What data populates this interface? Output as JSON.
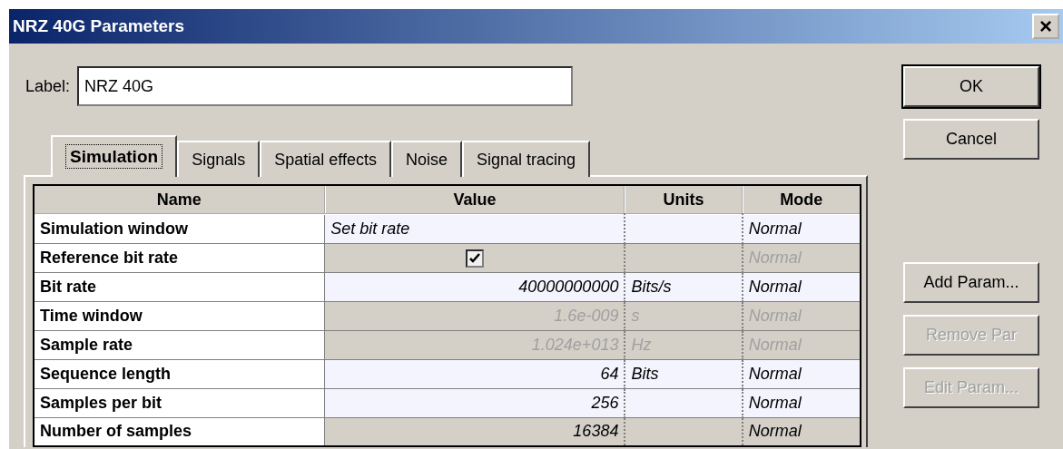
{
  "window": {
    "title": "NRZ 40G Parameters",
    "close": "×"
  },
  "label_field": {
    "label": "Label:",
    "value": "NRZ 40G"
  },
  "tabs": [
    {
      "label": "Simulation",
      "selected": true
    },
    {
      "label": "Signals",
      "selected": false
    },
    {
      "label": "Spatial effects",
      "selected": false
    },
    {
      "label": "Noise",
      "selected": false
    },
    {
      "label": "Signal tracing",
      "selected": false
    }
  ],
  "table": {
    "columns": [
      "Name",
      "Value",
      "Units",
      "Mode"
    ],
    "rows": [
      {
        "name": "Simulation window",
        "kind": "text",
        "value": "Set bit rate",
        "units": "",
        "mode": "Normal",
        "editable": true,
        "disabled": false
      },
      {
        "name": "Reference bit rate",
        "kind": "checkbox",
        "checked": true,
        "units": "",
        "mode": "Normal",
        "editable": false,
        "disabled": true
      },
      {
        "name": "Bit rate",
        "kind": "number",
        "value": "40000000000",
        "units": "Bits/s",
        "mode": "Normal",
        "editable": true,
        "disabled": false
      },
      {
        "name": "Time window",
        "kind": "number",
        "value": "1.6e-009",
        "units": "s",
        "mode": "Normal",
        "editable": false,
        "disabled": true
      },
      {
        "name": "Sample rate",
        "kind": "number",
        "value": "1.024e+013",
        "units": "Hz",
        "mode": "Normal",
        "editable": false,
        "disabled": true
      },
      {
        "name": "Sequence length",
        "kind": "number",
        "value": "64",
        "units": "Bits",
        "mode": "Normal",
        "editable": true,
        "disabled": false
      },
      {
        "name": "Samples per bit",
        "kind": "number",
        "value": "256",
        "units": "",
        "mode": "Normal",
        "editable": true,
        "disabled": false
      },
      {
        "name": "Number of samples",
        "kind": "number",
        "value": "16384",
        "units": "",
        "mode": "Normal",
        "editable": false,
        "disabled": false
      }
    ]
  },
  "buttons_top": [
    {
      "label": "OK",
      "default": true,
      "disabled": false
    },
    {
      "label": "Cancel",
      "default": false,
      "disabled": false
    }
  ],
  "buttons_side": [
    {
      "label": "Add Param...",
      "disabled": false
    },
    {
      "label": "Remove Par",
      "disabled": true
    },
    {
      "label": "Edit Param...",
      "disabled": true
    }
  ]
}
